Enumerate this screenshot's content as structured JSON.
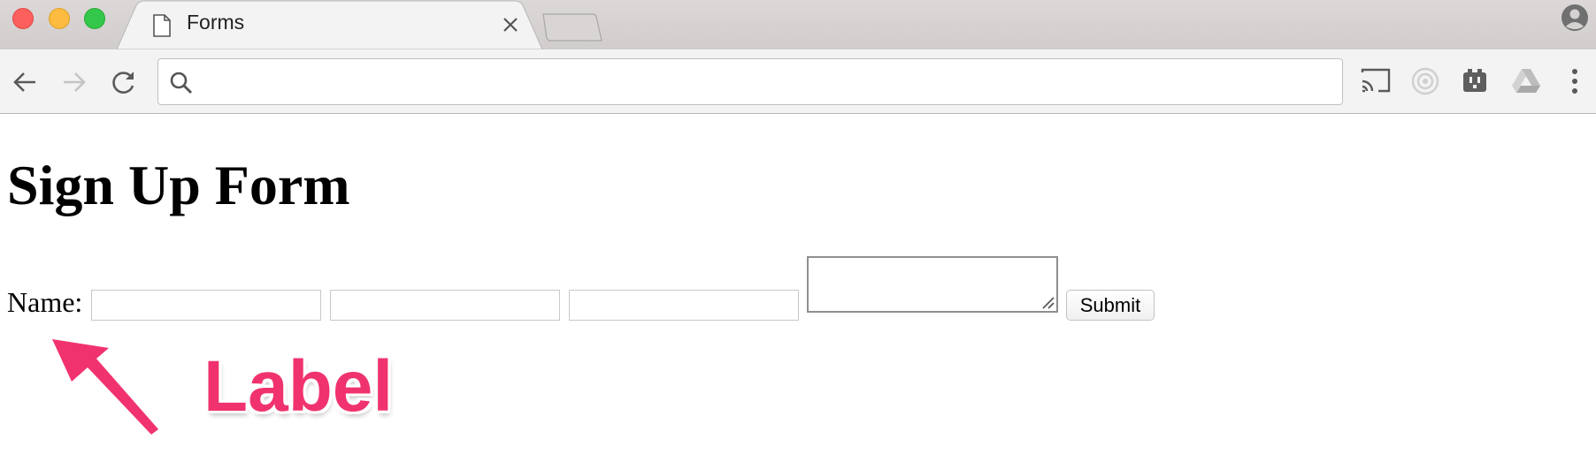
{
  "browser": {
    "tab": {
      "title": "Forms",
      "icon": "document-icon"
    },
    "address_bar": {
      "value": "",
      "placeholder": ""
    },
    "toolbar_icons": [
      "back-icon",
      "forward-icon",
      "reload-icon",
      "search-icon",
      "cast-icon",
      "target-extension-icon",
      "outlet-extension-icon",
      "drive-icon",
      "menu-icon"
    ],
    "colors": {
      "close": "#fc605c",
      "minimize": "#fdbc40",
      "maximize": "#34c84a"
    }
  },
  "page": {
    "heading": "Sign Up Form",
    "form": {
      "label": "Name:",
      "fields": [
        {
          "value": "",
          "placeholder": ""
        },
        {
          "value": "",
          "placeholder": ""
        },
        {
          "value": "",
          "placeholder": ""
        }
      ],
      "textarea": {
        "value": ""
      },
      "submit_label": "Submit"
    }
  },
  "annotation": {
    "text": "Label",
    "color": "#f0336e"
  }
}
